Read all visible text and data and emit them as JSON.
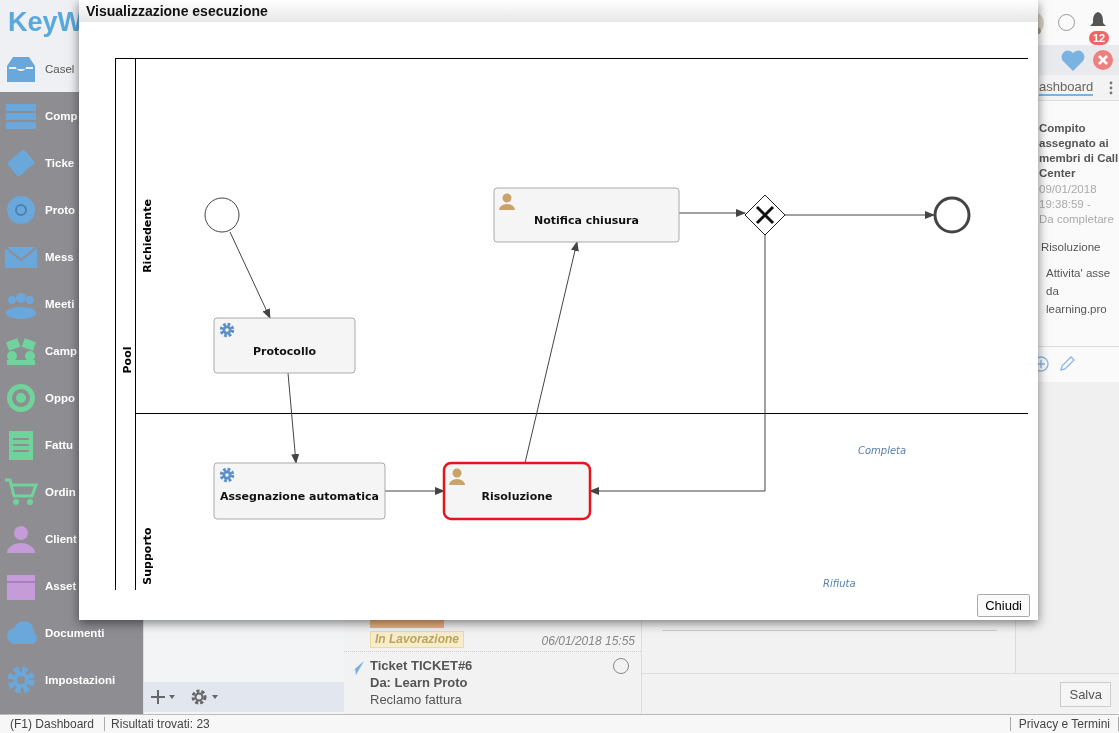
{
  "app": {
    "logo": "KeyW",
    "notification_count": "12"
  },
  "sidebar": {
    "items": [
      {
        "label": "Casel",
        "selected": true
      },
      {
        "label": "Comp",
        "selected": false
      },
      {
        "label": "Ticke",
        "selected": false
      },
      {
        "label": "Proto",
        "selected": false
      },
      {
        "label": "Mess",
        "selected": false
      },
      {
        "label": "Meeti",
        "selected": false
      },
      {
        "label": "Camp",
        "selected": false
      },
      {
        "label": "Oppo",
        "selected": false
      },
      {
        "label": "Fattu",
        "selected": false
      },
      {
        "label": "Ordin",
        "selected": false
      },
      {
        "label": "Client",
        "selected": false
      },
      {
        "label": "Asset",
        "selected": false
      },
      {
        "label": "Documenti",
        "selected": false
      },
      {
        "label": "Impostazioni",
        "selected": false
      }
    ]
  },
  "list": {
    "tags": [
      {
        "label": "In Lavorazione",
        "kind": "status"
      }
    ],
    "date": "06/01/2018 15:55",
    "ticket": {
      "title": "Ticket TICKET#6",
      "sender": "Da: Learn Proto",
      "subject": "Reclamo fattura",
      "checked": false
    }
  },
  "detail": {
    "tab": {
      "label": "ashboard",
      "selected": true
    },
    "title": "Compito assegnato ai membri di Call Center",
    "meta": "09/01/2018\n19:38:59 -\nDa completare",
    "task": "Risoluzione",
    "note": "Attivita' asse\nda\nlearning.pro"
  },
  "save_button": "Salva",
  "status_bar": [
    "(F1) Dashboard",
    "Risultati trovati: 23",
    "Privacy e Termini"
  ],
  "dialog": {
    "title": "Visualizzazione esecuzione",
    "pool": "Pool",
    "lanes": [
      "Richiedente",
      "Supporto"
    ],
    "nodes": [
      {
        "kind": "start"
      },
      {
        "kind": "user_task",
        "label": "Notifica chiusura",
        "active": false
      },
      {
        "kind": "gateway"
      },
      {
        "kind": "end"
      },
      {
        "kind": "service_task",
        "label": "Protocollo",
        "active": false
      },
      {
        "kind": "service_task",
        "label": "Assegnazione automatica",
        "active": false
      },
      {
        "kind": "user_task",
        "label": "Risoluzione",
        "active": true
      }
    ],
    "flow_labels": [
      "Completa",
      "Rifiuta"
    ],
    "close_button": "Chiudi"
  }
}
